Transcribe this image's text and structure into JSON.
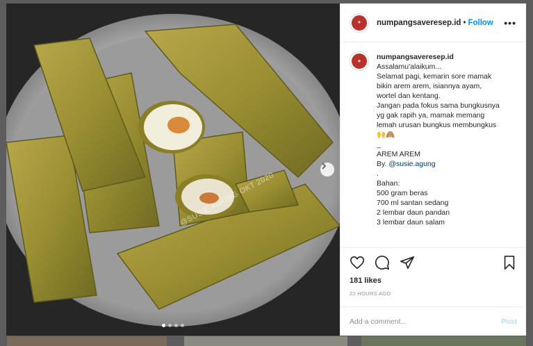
{
  "post": {
    "username": "numpangsaveresep.id",
    "follow_label": "Follow",
    "more_label": "•••",
    "separator": "•",
    "watermark": "@SUSIE.AGUNG OKT 2020",
    "caption_lines": [
      "Assalamu'alaikum...",
      "Selamat pagi, kemarin sore mamak",
      "bikin arem arem, isiannya ayam,",
      "wortel dan kentang.",
      "Jangan pada fokus sama bungkusnya",
      "yg gak rapih ya, mamak memang",
      "lemah urusan bungkus membungkus",
      "🙌🙈",
      "",
      "_",
      "AREM AREM",
      "By. @susie.agung",
      ".",
      "Bahan:",
      "500 gram beras",
      "700 ml santan sedang",
      "2 lembar daun pandan",
      "3 lembar daun salam"
    ],
    "caption_by_prefix": "By. ",
    "caption_mention": "@susie.agung",
    "likes": "181 likes",
    "time": "22 HOURS AGO",
    "comment_placeholder": "Add a comment...",
    "post_label": "Post",
    "icons": {
      "like": "heart-icon",
      "comment": "comment-icon",
      "share": "share-icon",
      "save": "bookmark-icon",
      "next": "chevron-right-icon"
    },
    "colors": {
      "accent": "#0095f6",
      "post_disabled": "#b2dffc",
      "avatar": "#b8322b"
    }
  }
}
